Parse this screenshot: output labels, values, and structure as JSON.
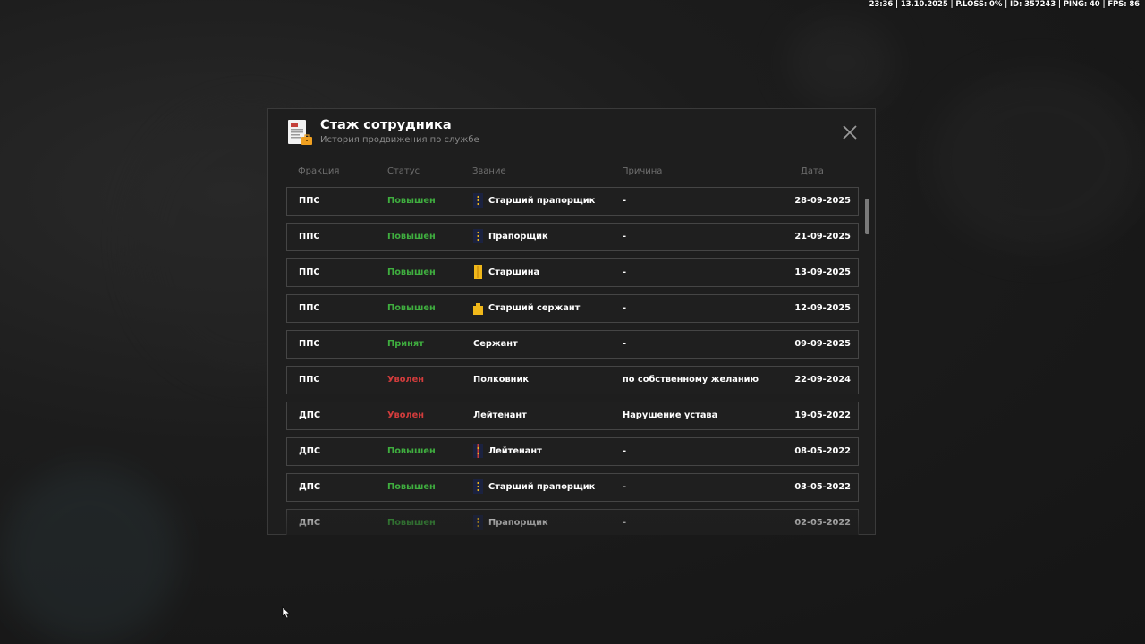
{
  "hud": {
    "status_line": "23:36 | 13.10.2025 | P.LOSS: 0% | ID: 357243 | PING: 40 | FPS: 86"
  },
  "dialog": {
    "title": "Стаж сотрудника",
    "subtitle": "История продвижения по службе",
    "icon": "document-icon",
    "close_icon": "close-icon"
  },
  "columns": {
    "faction": "Фракция",
    "status": "Статус",
    "rank": "Звание",
    "reason": "Причина",
    "date": "Дата"
  },
  "colors": {
    "status_promoted": "#3fae3f",
    "status_hired": "#3fae3f",
    "status_fired": "#d23c3c",
    "accent_gold": "#f0b81a",
    "row_border": "#454545"
  },
  "rows": [
    {
      "faction": "ППС",
      "status": "Повышен",
      "status_type": "promoted",
      "rank_icon": "insignia-stripe-dots-icon",
      "rank": "Старший прапорщик",
      "reason": "-",
      "date": "28-09-2025"
    },
    {
      "faction": "ППС",
      "status": "Повышен",
      "status_type": "promoted",
      "rank_icon": "insignia-stripe-dots-icon",
      "rank": "Прапорщик",
      "reason": "-",
      "date": "21-09-2025"
    },
    {
      "faction": "ППС",
      "status": "Повышен",
      "status_type": "promoted",
      "rank_icon": "insignia-gold-bar-icon",
      "rank": "Старшина",
      "reason": "-",
      "date": "13-09-2025"
    },
    {
      "faction": "ППС",
      "status": "Повышен",
      "status_type": "promoted",
      "rank_icon": "insignia-gold-chevron-icon",
      "rank": "Старший сержант",
      "reason": "-",
      "date": "12-09-2025"
    },
    {
      "faction": "ППС",
      "status": "Принят",
      "status_type": "hired",
      "rank_icon": "",
      "rank": "Сержант",
      "reason": "-",
      "date": "09-09-2025"
    },
    {
      "faction": "ППС",
      "status": "Уволен",
      "status_type": "fired",
      "rank_icon": "",
      "rank": "Полковник",
      "reason": "по собственному желанию",
      "date": "22-09-2024"
    },
    {
      "faction": "ДПС",
      "status": "Уволен",
      "status_type": "fired",
      "rank_icon": "",
      "rank": "Лейтенант",
      "reason": "Нарушение устава",
      "date": "19-05-2022"
    },
    {
      "faction": "ДПС",
      "status": "Повышен",
      "status_type": "promoted",
      "rank_icon": "insignia-red-stripe-icon",
      "rank": "Лейтенант",
      "reason": "-",
      "date": "08-05-2022"
    },
    {
      "faction": "ДПС",
      "status": "Повышен",
      "status_type": "promoted",
      "rank_icon": "insignia-stripe-dots-icon",
      "rank": "Старший прапорщик",
      "reason": "-",
      "date": "03-05-2022"
    },
    {
      "faction": "ДПС",
      "status": "Повышен",
      "status_type": "promoted",
      "rank_icon": "insignia-stripe-dots-icon",
      "rank": "Прапорщик",
      "reason": "-",
      "date": "02-05-2022"
    }
  ],
  "scroll": {
    "position_fraction": 0.0
  }
}
